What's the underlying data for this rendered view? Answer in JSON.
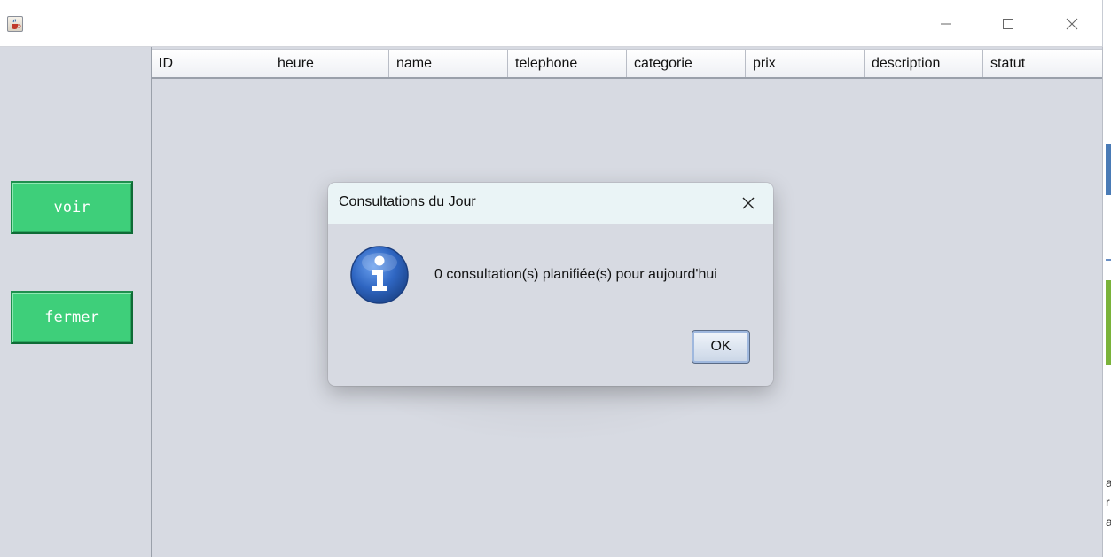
{
  "window": {
    "icon": "java-cup-icon",
    "controls": {
      "minimize": "minimize-icon",
      "maximize": "maximize-icon",
      "close": "close-icon"
    }
  },
  "left_panel": {
    "voir_label": "voir",
    "fermer_label": "fermer",
    "button_color": "#3ecf7a"
  },
  "table": {
    "columns": [
      "ID",
      "heure",
      "name",
      "telephone",
      "categorie",
      "prix",
      "description",
      "statut"
    ],
    "rows": []
  },
  "dialog": {
    "title": "Consultations du Jour",
    "message": "0 consultation(s) planifiée(s) pour aujourd'hui",
    "ok_label": "OK",
    "icon": "info-icon",
    "icon_color": "#2f66c2"
  },
  "background_window": {
    "edge_text": [
      "a",
      "r",
      "a"
    ]
  }
}
